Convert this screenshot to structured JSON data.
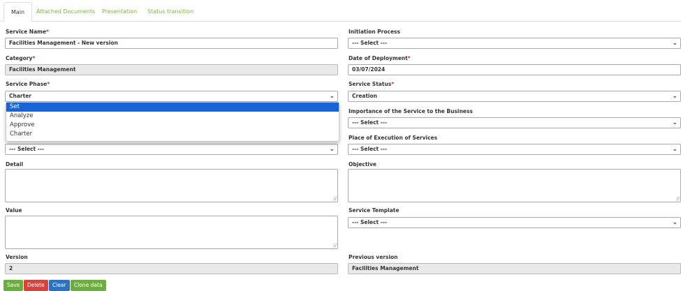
{
  "tabs": [
    "Main",
    "Attached Documents",
    "Presentation",
    "Status transition"
  ],
  "left": {
    "service_name": {
      "label": "Service Name",
      "required": "*",
      "value": "Facilities Management - New version"
    },
    "category": {
      "label": "Category",
      "required": "*",
      "value": "Facilities Management"
    },
    "service_phase": {
      "label": "Service Phase",
      "required": "*",
      "value": "Charter"
    },
    "hidden_select": {
      "value": "--- Select ---"
    },
    "detail": {
      "label": "Detail"
    },
    "value": {
      "label": "Value"
    },
    "version": {
      "label": "Version",
      "value": "2"
    }
  },
  "dropdown": {
    "options": [
      "Set",
      "Analyze",
      "Approve",
      "Charter"
    ],
    "highlighted": "Set"
  },
  "right": {
    "initiation_process": {
      "label": "Initiation Process",
      "value": "--- Select ---"
    },
    "date_of_deployment": {
      "label": "Date of Deployment",
      "required": "*",
      "value": "03/07/2024"
    },
    "service_status": {
      "label": "Service Status",
      "required": "*",
      "value": "Creation"
    },
    "importance": {
      "label": "Importance of the Service to the Business",
      "value": "--- Select ---"
    },
    "place_of_execution": {
      "label": "Place of Execution of Services",
      "value": "--- Select ---"
    },
    "objective": {
      "label": "Objective"
    },
    "service_template": {
      "label": "Service Template",
      "value": "--- Select ---"
    },
    "previous_version": {
      "label": "Previous version",
      "value": "Facilities Management"
    }
  },
  "buttons": {
    "save": "Save",
    "delete": "Delete",
    "clear": "Clear",
    "clone": "Clone data"
  },
  "colors": {
    "accent_green": "#6aae3d",
    "danger_red": "#d9423b",
    "primary_blue": "#2a73c4",
    "highlight_blue": "#1665d8",
    "required_red": "#c0392b"
  },
  "icons": {
    "select_arrow": "chevron-down-icon",
    "resize": "resize-grip-icon"
  }
}
